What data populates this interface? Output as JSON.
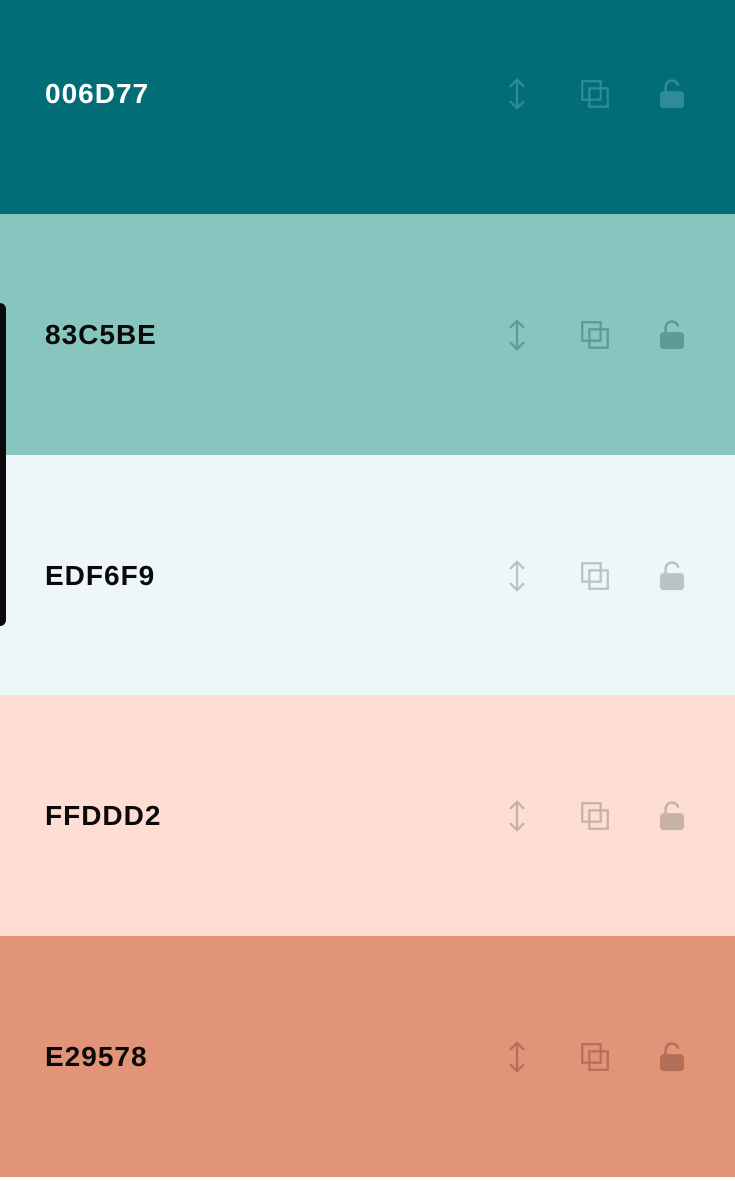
{
  "palette": {
    "swatches": [
      {
        "hex": "006D77",
        "background": "#006D77",
        "text_color": "#FFFFFF",
        "icon_color": "#2E8C95"
      },
      {
        "hex": "83C5BE",
        "background": "#87C5BE",
        "text_color": "#0A0A0A",
        "icon_color": "#5F9A94"
      },
      {
        "hex": "EDF6F9",
        "background": "#EDF6F9",
        "text_color": "#0A0A0A",
        "icon_color": "#B9C2C5"
      },
      {
        "hex": "FFDDD2",
        "background": "#FEDDD2",
        "text_color": "#0A0A0A",
        "icon_color": "#C7B1A9"
      },
      {
        "hex": "E29578",
        "background": "#E19478",
        "text_color": "#0A0A0A",
        "icon_color": "#B46F58"
      }
    ]
  },
  "icons": {
    "move": "arrows-vertical-icon",
    "copy": "copy-icon",
    "lock": "unlock-icon"
  }
}
